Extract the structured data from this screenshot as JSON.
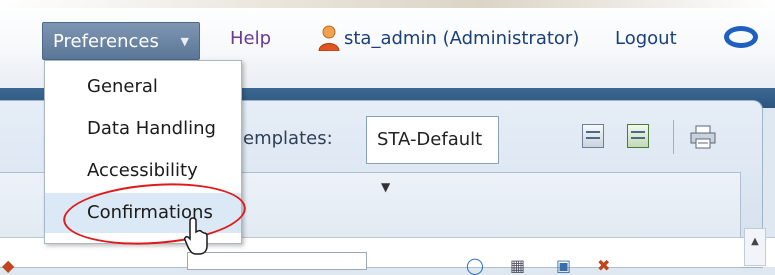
{
  "header": {
    "preferences_label": "Preferences",
    "help_label": "Help",
    "user_label": "sta_admin (Administrator)",
    "logout_label": "Logout"
  },
  "preferences_menu": {
    "items": [
      {
        "label": "General"
      },
      {
        "label": "Data Handling"
      },
      {
        "label": "Accessibility"
      },
      {
        "label": "Confirmations",
        "highlighted": true
      }
    ]
  },
  "toolbar": {
    "templates_label": "emplates:",
    "template_value": "STA-Default"
  },
  "colors": {
    "button_bg": "#6c86a6",
    "link_purple": "#6a3a8e",
    "menu_highlight": "#dbe8f5",
    "annotation_red": "#e01a1a",
    "oracle_logo_blue": "#1f5fbf"
  },
  "icons": [
    "chevron-down-icon",
    "user-icon",
    "oracle-logo-icon",
    "edit-template-icon",
    "save-template-icon",
    "print-icon",
    "cursor-icon",
    "scroll-up-icon"
  ]
}
